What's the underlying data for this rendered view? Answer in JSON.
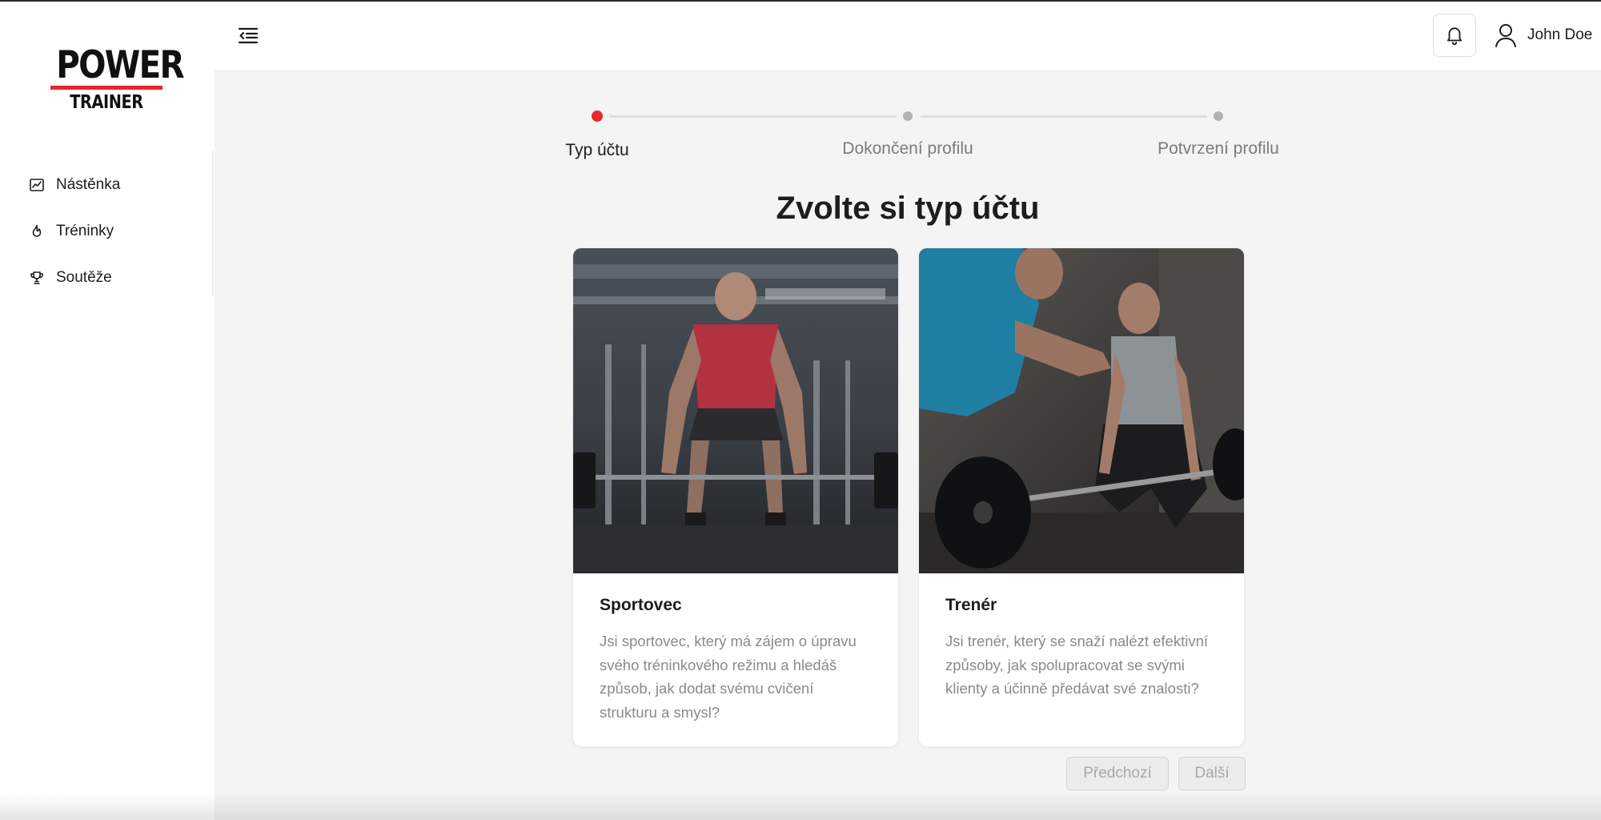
{
  "logo": {
    "line1": "POWER",
    "line2": "TRAINER",
    "accent": "#e02a2a"
  },
  "sidebar": {
    "items": [
      {
        "label": "Nástěnka",
        "icon": "chart-line-icon"
      },
      {
        "label": "Tréninky",
        "icon": "flame-icon"
      },
      {
        "label": "Soutěže",
        "icon": "trophy-icon"
      }
    ]
  },
  "header": {
    "menu_icon": "menu-collapse-icon",
    "notification_icon": "bell-icon",
    "user_icon": "user-icon",
    "user_name": "John Doe"
  },
  "stepper": {
    "steps": [
      {
        "label": "Typ účtu",
        "active": true
      },
      {
        "label": "Dokončení profilu",
        "active": false
      },
      {
        "label": "Potvrzení profilu",
        "active": false
      }
    ],
    "active_color": "#e42929"
  },
  "main": {
    "title": "Zvolte si typ účtu",
    "cards": [
      {
        "title": "Sportovec",
        "description": "Jsi sportovec, který má zájem o úpravu svého tréninkového režimu a hledáš způsob, jak dodat svému cvičení strukturu a smysl?"
      },
      {
        "title": "Trenér",
        "description": "Jsi trenér, který se snaží nalézt efektivní způsoby, jak spolupracovat se svými klienty a účinně předávat své znalosti?"
      }
    ],
    "buttons": {
      "prev": "Předchozí",
      "next": "Další"
    }
  }
}
